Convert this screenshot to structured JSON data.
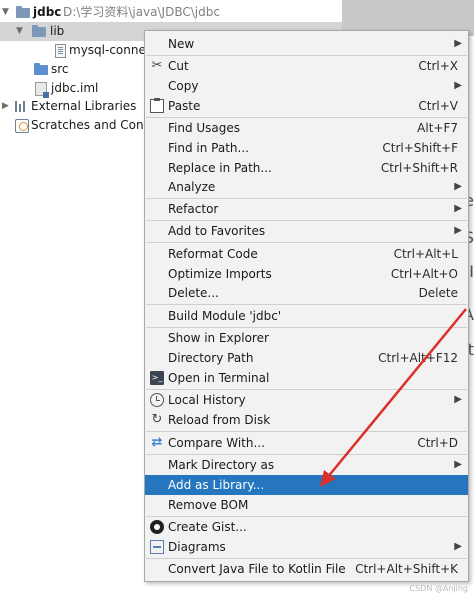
{
  "tree": {
    "root_name": "jdbc",
    "root_path": "D:\\学习资料\\java\\JDBC\\jdbc",
    "lib": "lib",
    "jar": "mysql-connec",
    "src": "src",
    "iml": "jdbc.iml",
    "external_libraries": "External Libraries",
    "scratches": "Scratches and Conso"
  },
  "editor_fragments": [
    "ne",
    "S",
    "I",
    "A",
    "t"
  ],
  "menu": {
    "new": "New",
    "cut": "Cut",
    "cut_sc": "Ctrl+X",
    "copy": "Copy",
    "paste": "Paste",
    "paste_sc": "Ctrl+V",
    "find_usages": "Find Usages",
    "find_usages_sc": "Alt+F7",
    "find_in_path": "Find in Path...",
    "find_in_path_sc": "Ctrl+Shift+F",
    "replace_in_path": "Replace in Path...",
    "replace_in_path_sc": "Ctrl+Shift+R",
    "analyze": "Analyze",
    "refactor": "Refactor",
    "add_to_favorites": "Add to Favorites",
    "reformat_code": "Reformat Code",
    "reformat_code_sc": "Ctrl+Alt+L",
    "optimize_imports": "Optimize Imports",
    "optimize_imports_sc": "Ctrl+Alt+O",
    "delete": "Delete...",
    "delete_sc": "Delete",
    "build_module": "Build Module 'jdbc'",
    "show_in_explorer": "Show in Explorer",
    "directory_path": "Directory Path",
    "directory_path_sc": "Ctrl+Alt+F12",
    "open_in_terminal": "Open in Terminal",
    "local_history": "Local History",
    "reload_from_disk": "Reload from Disk",
    "compare_with": "Compare With...",
    "compare_with_sc": "Ctrl+D",
    "mark_directory_as": "Mark Directory as",
    "add_as_library": "Add as Library...",
    "remove_bom": "Remove BOM",
    "create_gist": "Create Gist...",
    "diagrams": "Diagrams",
    "convert_kotlin": "Convert Java File to Kotlin File",
    "convert_kotlin_sc": "Ctrl+Alt+Shift+K"
  },
  "watermark": "CSDN @Anjing",
  "colors": {
    "highlight": "#2675bf",
    "arrow": "#d9302a",
    "menu_bg": "#f2f2f2"
  }
}
